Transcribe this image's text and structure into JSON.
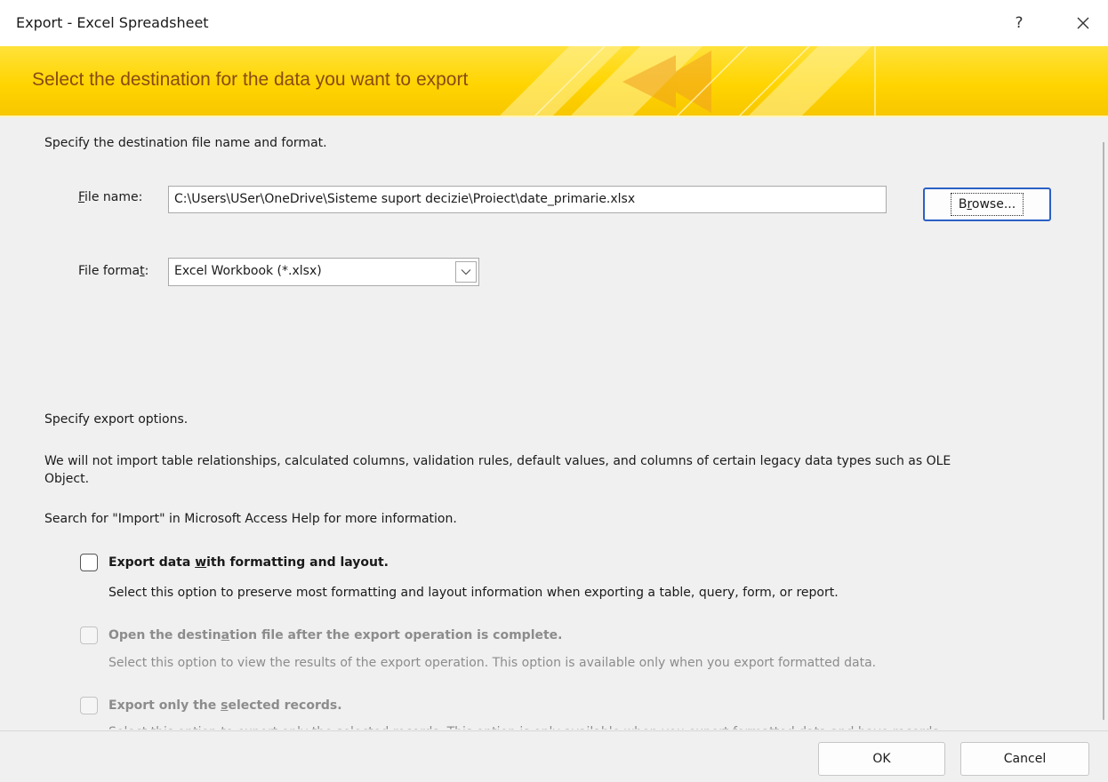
{
  "window": {
    "title": "Export - Excel Spreadsheet",
    "help_label": "?",
    "close_label": "✕"
  },
  "banner": {
    "heading": "Select the destination for the data you want to export",
    "colors": {
      "top": "#ffe23a",
      "bottom": "#f7c600",
      "text": "#8a4a12"
    }
  },
  "destination": {
    "intro": "Specify the destination file name and format.",
    "file_name_label_pre": "",
    "file_name_label_u": "F",
    "file_name_label_post": "ile name:",
    "file_name_value": "C:\\Users\\USer\\OneDrive\\Sisteme suport decizie\\Proiect\\date_primarie.xlsx",
    "browse_pre": "B",
    "browse_u": "r",
    "browse_post": "owse...",
    "file_format_label_pre": "File forma",
    "file_format_label_u": "t",
    "file_format_label_post": ":",
    "file_format_value": "Excel Workbook (*.xlsx)"
  },
  "options": {
    "intro": "Specify export options.",
    "notice_line1": "We will not import table relationships, calculated columns, validation rules, default values, and columns of certain legacy data types such as OLE",
    "notice_line2": "Object.",
    "help_hint": "Search for \"Import\" in Microsoft Access Help for more information.",
    "items": [
      {
        "title_pre": "Export data ",
        "title_u": "w",
        "title_post": "ith formatting and layout.",
        "description": "Select this option to preserve most formatting and layout information when exporting a table, query, form, or report.",
        "checked": false,
        "enabled": true
      },
      {
        "title_pre": "Open the destin",
        "title_u": "a",
        "title_post": "tion file after the export operation is complete.",
        "description": "Select this option to view the results of the export operation. This option is available only when you export formatted data.",
        "checked": false,
        "enabled": false
      },
      {
        "title_pre": "Export only the ",
        "title_u": "s",
        "title_post": "elected records.",
        "description": "Select this option to export only the selected records. This option is only available when you export formatted data and have records",
        "checked": false,
        "enabled": false
      }
    ]
  },
  "footer": {
    "ok_label": "OK",
    "cancel_label": "Cancel"
  },
  "icons": {
    "dropdown": "chevron-down-icon",
    "close": "close-icon"
  }
}
